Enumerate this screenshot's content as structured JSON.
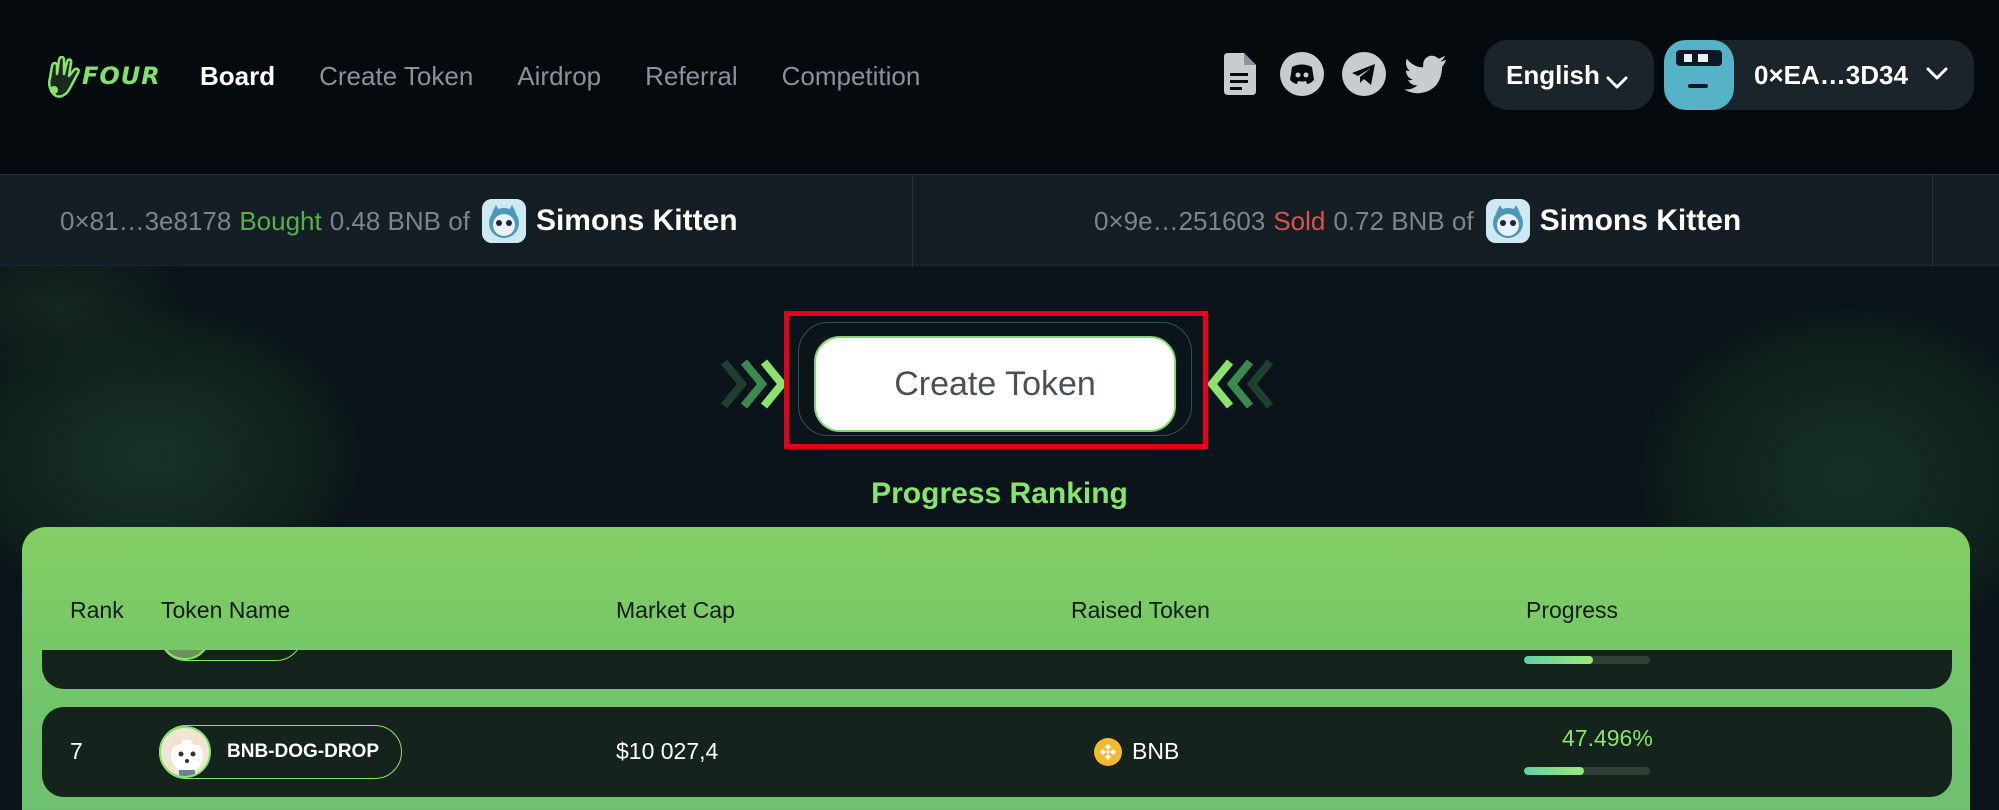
{
  "header": {
    "logo_text": "FOUR",
    "nav": [
      {
        "label": "Board",
        "active": true
      },
      {
        "label": "Create Token",
        "active": false
      },
      {
        "label": "Airdrop",
        "active": false
      },
      {
        "label": "Referral",
        "active": false
      },
      {
        "label": "Competition",
        "active": false
      }
    ],
    "social_icons": [
      "document-icon",
      "discord-icon",
      "telegram-icon",
      "twitter-icon"
    ],
    "language": "English",
    "wallet_address": "0×EA…3D34"
  },
  "ticker": [
    {
      "address": "0×81…3e8178",
      "action": "Bought",
      "amount": "0.48 BNB of",
      "token": "Simons Kitten"
    },
    {
      "address": "0×9e…251603",
      "action": "Sold",
      "amount": "0.72 BNB of",
      "token": "Simons Kitten"
    }
  ],
  "hero": {
    "create_button": "Create Token",
    "ranking_title": "Progress Ranking"
  },
  "table": {
    "columns": [
      "Rank",
      "Token Name",
      "Market Cap",
      "Raised Token",
      "Progress"
    ],
    "rows": [
      {
        "rank": "",
        "token": "",
        "market_cap": "",
        "raised": "",
        "progress_text": "",
        "progress": 0.55
      },
      {
        "rank": "7",
        "token": "BNB-DOG-DROP",
        "market_cap": "$10 027,4",
        "raised": "BNB",
        "progress_text": "47.496%",
        "progress": 0.47496
      }
    ]
  },
  "colors": {
    "accent_green": "#86e56c",
    "buy": "#57b14a",
    "sell": "#d9534f",
    "highlight_box": "#e5001c"
  }
}
